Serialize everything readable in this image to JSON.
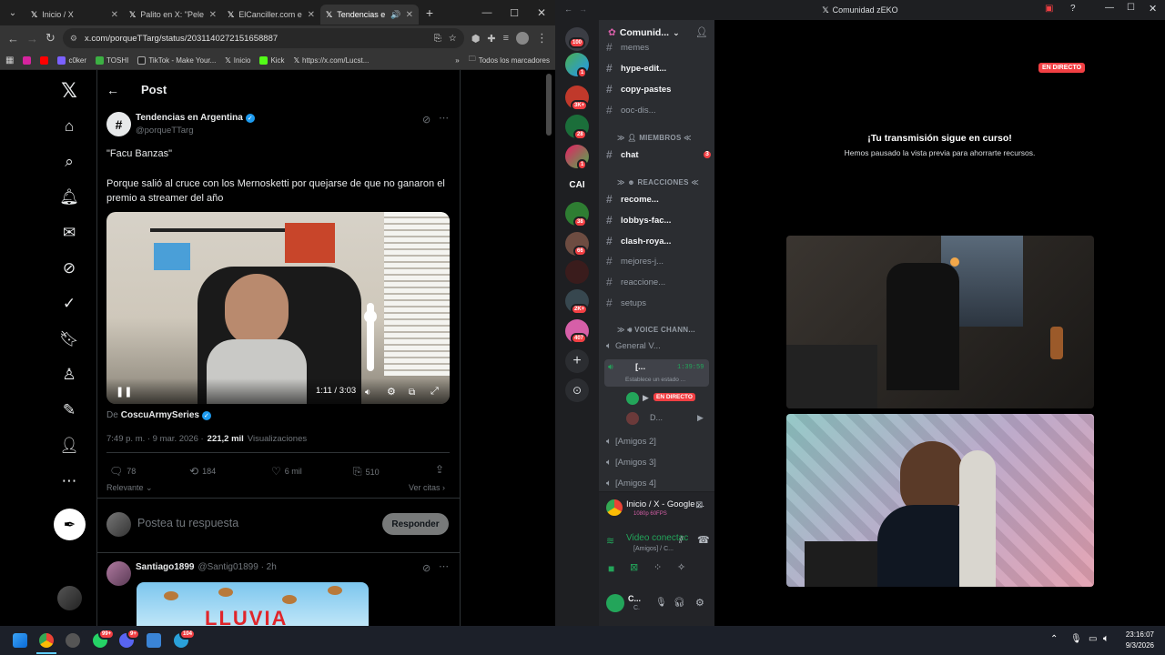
{
  "browser": {
    "tabs": [
      {
        "title": "Inicio / X"
      },
      {
        "title": "Palito en X: \"Pele"
      },
      {
        "title": "ElCanciller.com e"
      },
      {
        "title": "Tendencias e"
      }
    ],
    "url": "x.com/porqueTTarg/status/2031140272151658887",
    "bookmarks": [
      {
        "label": "c0ker"
      },
      {
        "label": "TOSHI"
      },
      {
        "label": "TikTok - Make Your..."
      },
      {
        "label": "Inicio"
      },
      {
        "label": "Kick"
      },
      {
        "label": "https://x.com/Lucst..."
      }
    ],
    "all_bookmarks": "Todos los marcadores"
  },
  "x": {
    "header_title": "Post",
    "author_name": "Tendencias en Argentina",
    "author_handle": "@porqueTTarg",
    "avatar_letter": "#",
    "post_line1": "\"Facu Banzas\"",
    "post_line2": "Porque salió al cruce con los Mernosketti por quejarse de que no ganaron el premio a streamer del año",
    "video_time": "1:11 / 3:03",
    "from_prefix": "De",
    "from_account": "CoscuArmySeries",
    "timestamp": "7:49 p. m. · 9 mar. 2026 ·",
    "views_count": "221,2 mil",
    "views_label": "Visualizaciones",
    "stats": {
      "replies": "78",
      "reposts": "184",
      "likes": "6 mil",
      "bookmarks": "510"
    },
    "sort_label": "Relevante",
    "quotes_label": "Ver citas",
    "reply_placeholder": "Postea tu respuesta",
    "reply_button": "Responder",
    "reply_author": "Santiago1899",
    "reply_meta": "@Santig01899 · 2h",
    "reply_image_text": "LLUVIA"
  },
  "discord": {
    "window_title": "Comunidad zEKO",
    "server_name": "Comunid...",
    "servers": [
      {
        "badge": "100"
      },
      {
        "badge": "1"
      },
      {
        "badge": "3K+"
      },
      {
        "badge": "28"
      },
      {
        "badge": "1"
      },
      {
        "label": "CAI"
      },
      {
        "badge": "38"
      },
      {
        "badge": "66"
      },
      {
        "badge": ""
      },
      {
        "badge": "2K+"
      },
      {
        "badge": "407"
      }
    ],
    "channels_top": [
      {
        "name": "memes"
      },
      {
        "name": "hype-edit..."
      },
      {
        "name": "copy-pastes"
      },
      {
        "name": "ooc-dis..."
      }
    ],
    "cat_members": "MIEMBROS",
    "chat_channel": "chat",
    "chat_badge": "3",
    "cat_reactions": "REACCIONES",
    "reaction_channels": [
      {
        "name": "recome..."
      },
      {
        "name": "lobbys-fac..."
      },
      {
        "name": "clash-roya..."
      },
      {
        "name": "mejores-j..."
      },
      {
        "name": "reaccione..."
      },
      {
        "name": "setups"
      }
    ],
    "cat_voice": "VOICE CHANN...",
    "voice_general": "General V...",
    "voice_active": "[...",
    "voice_timer": "1:39:59",
    "voice_status": "Establece un estado ...",
    "live_badge": "EN DIRECTO",
    "user_d": "D...",
    "voice_friends": [
      {
        "name": "[Amigos 2]"
      },
      {
        "name": "[Amigos 3]"
      },
      {
        "name": "[Amigos 4]"
      }
    ],
    "stream_title": "Inicio / X - Google ...",
    "stream_quality": "1080p 60FPS",
    "voice_connected": "Video conectac",
    "voice_connected_sub": "[Amigos] / C...",
    "self_name": "C...",
    "self_sub": "C.",
    "stage_live": "EN DIRECTO",
    "stream_paused_title": "¡Tu transmisión sigue en curso!",
    "stream_paused_sub": "Hemos pausado la vista previa para ahorrarte recursos."
  },
  "taskbar": {
    "time": "23:16:07",
    "date": "9/3/2026",
    "badges": {
      "whatsapp": "99+",
      "discord": "9+",
      "telegram": "104"
    }
  },
  "colors": {
    "x_blue": "#1d9bf0",
    "discord_red": "#f23f43",
    "discord_green": "#23a55a"
  }
}
